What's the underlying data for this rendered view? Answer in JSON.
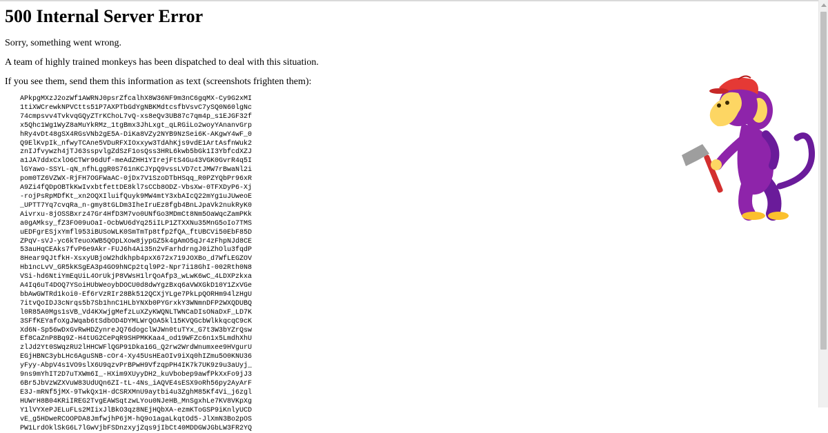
{
  "page": {
    "title": "500 Internal Server Error",
    "message_1": "Sorry, something went wrong.",
    "message_2": "A team of highly trained monkeys has been dispatched to deal with this situation.",
    "message_3": "If you see them, send them this information as text (screenshots frighten them):",
    "error_code": "APkpgMXzJ2ozWf1AWRNJ0psrZfcalhX8W36NF9m3nC6gqMX-Cy9G2xMI\n1tiXWCrewkNPVCtts51P7AXPTbGdYgNBKMdtcsfbVsvC7ySQ0N60lgNc\n74cmpsvv4TvkvqGQyZTrKChoL7vQ-xs8eQv3UB87c7qm4p_s1EJGF32f\nx5Qhc1Wg1WyZ8aMuYkRMz_1tgBmx3JhLxgt_qLRGiLo2woyYAnanvGrp\nhRy4vDt48gSX4RGsVNb2gE5A-DiKa8VZy2NYB9NzSei6K-AKgwY4wF_0\nQ9ElKvpIk_nfwyTCAne5VDuRFXIOxxyw3TdAhKjs9vdE1ArtAsfnWuk2\nznIJfvywzh4jTJ63sspvlgZdSzF1osQss3HRL6kwb5bGk1I3YbfcdXZJ\na1JA7ddxCxlO6CTWr96dUf-meAdZHH1YIrejFtS4Gu43VGK0GvrR4q5I\nlGYawo-SSYL-qN_nfhLggR0S761nKCJYpQ9vssLVD7ctJMW7rBwaNl2i\npom0TZ6VZWX-RjFH7OGFWaAC-0jDx7V1SzoDTbHSqq_R0PZYQbPr96xR\nA9Zi4fQDpOBTkKwIvxbtfettDE8kl7sCCb8ODZ-VbsXw-0TFXDyP6-Xj\n-rojPsRpMDfKt_xn2OQXIluifQuyk9MW4mtY3xbAIcQ22mYg1uJUweoE\n_UPTT7Yq7cvqRa_n-gmy8tGLDm3IheIruEz8fgb4BnLJpaVk2nukRyK0\nAivrxu-8jOSSBxrz47Gr4HfD3M7vo0UNfGo3MDmCt8Nm5OaWqcZamPKk\na0gAMksy_fZ3FO09uOaI-OcbWU6dYq25iILP1ZTXXNu35MnG5oIo7TMS\nuEDFgrESjxYmfl953iBUSoWLK0SmTmTp8tfp2fQA_ftUBCVi50EbF85D\nZPqV-sVJ-yc6kTeuoXWB5QOpLXow8jypGZ5k4gAmO5qJr4zFhpNJd8CE\n53auHqCEAks7fvP6e9Akr-FUJ6h4Ai35n2vFarhdrngJ0iZhOlu3fqdP\n8Hear9QJtfkH-XsxyUBjoW2hdkhpb4pxX672x719JOXBo_d7WfLEGZOV\nHb1ncLvV_GR5kKSgEA3p4GO9hNCp2tql9P2-Npr7i18GhI-002Rth0N8\nVSi-hd6NtiYmEqUiL4OrUkjP8VWsH1lrQoAfp3_wLwK6wC_4LDXPzkxa\nA4Iq6uT4DOQ7YSoiHUbWeoybDOCU0d8dwYgzBxq6aVWXGkD10Y1ZxVGe\nbbAwGWTRd1koi0-Ef6rVzRIr28Bk512QCXjYLge7PkLpQORHm94lzHgU\n7itvQoIDJ3cNrqs5b7Sb1hnC1HLbYNXb0PYGrxkY3WNmnDFP2WXQDUBQ\nl0R85A0Mgs1sVB_Vd4KXwjgMefzLuXZyKWQNLTWNCaDIsONaDxF_LD7K\n3SFfKEYafoXgJWqab6tSdbOD4DYMLWrQOA5kl15KVQGcbWlkkqcqC9cK\nXd6N-Sp56wDxGvRwHDZynreJQ76dogclWJWn0tuTYx_G7t3W3bYZrQsw\nEf8CaZnP8Bq9Z-H4tUG2CePqR9SHPMKKaa4_od19WFZc6n1x5LmdhXhU\nzlJd2Yt0SWqzRU2lHHCWFlQGP91Dka16G_Q2rw2WrdWnumxee9HVgurU\nEGjHBNC3ybLHc6AguSNB-cOr4-Xy45UsHEaOIv9iXq0hIZmu5O0KNU36\nyFyy-AbpV4s1VO9slX6U9qzvPrBPwH9VfzqpPH4IK7k7UK9z9u3aUyj_\n9ns9mYhIT2D7uTXWm6I_-HXim9XUyyDH2_kuVbobep9awfPkXxFo9jJ3\n6Br5JbVzWZXVuW83UdUQn6ZI-tL-4Ns_iAQVE4sESX9oRh56py2AyArF\nE3J-mRNf5jMX-9TwkQx1H-dCSRXMnU9aytbi4u3ZghM85Kf4Vi_j6zgl\nHUWrH8B04KRiIREG2TvgEAWSqtzwLYou0NJeHB_MnSgxhLe7KV8VKpXg\nY1lVYXePJELuFLs2MIixJlBkO3qz8NEjHQbXA-ezmKToGSP9iKnlyUCD\nvE_g5HDweRCOOPDA8JmfwjhP6jM-hQ9o1agaLkqtOd5-JlXmN3Bo2pOS\nPW1LrdOklSkG6L7lGwVjbFSDnzxyjZqs9jIbCt40MDDGWJGbLW3FR2YQ"
  },
  "illustration": {
    "name": "monkey-with-hammer",
    "colors": {
      "body": "#8e24aa",
      "body_dark": "#6a1b9a",
      "face": "#fdd663",
      "cap": "#e53935",
      "hammer_head": "#9e9e9e",
      "hammer_handle": "#d32f2f",
      "feet": "#fbc02d"
    }
  }
}
